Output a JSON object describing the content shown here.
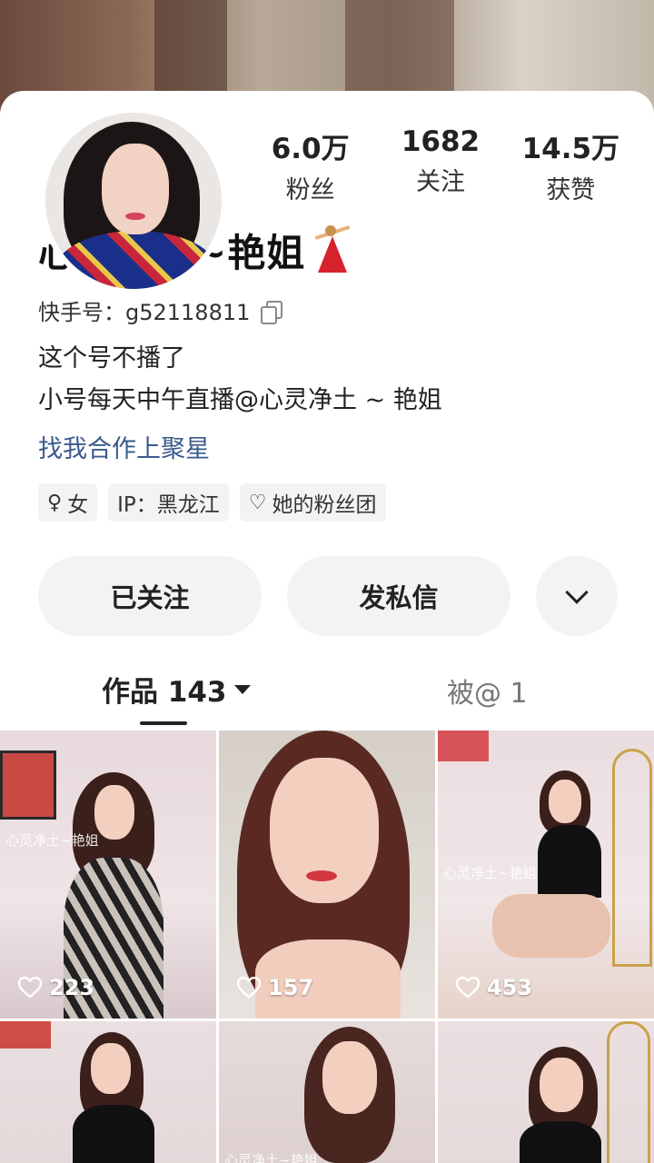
{
  "profile": {
    "name": "心灵净土~艳姐",
    "kuaishou_id": "快手号：g52118811",
    "bio_line1": "这个号不播了",
    "bio_line2": "小号每天中午直播@心灵净土 ~ 艳姐",
    "link": "找我合作上聚星"
  },
  "stats": [
    {
      "value": "6.0万",
      "label": "粉丝"
    },
    {
      "value": "1682",
      "label": "关注"
    },
    {
      "value": "14.5万",
      "label": "获赞"
    }
  ],
  "tags": [
    {
      "icon": "female-icon",
      "text": "女"
    },
    {
      "icon": "",
      "text": "IP：黑龙江"
    },
    {
      "icon": "heart-outline-icon",
      "text": "她的粉丝团"
    }
  ],
  "actions": {
    "follow": "已关注",
    "message": "发私信"
  },
  "tabs": {
    "works": "作品 143",
    "mentioned": "被@ 1"
  },
  "watermark": "心灵净土~艳姐",
  "videos": [
    {
      "likes": "223"
    },
    {
      "likes": "157"
    },
    {
      "likes": "453"
    },
    {
      "likes": ""
    },
    {
      "likes": ""
    },
    {
      "likes": ""
    }
  ],
  "colors": {
    "link": "#3a5a8c",
    "button_bg": "#f3f3f3",
    "text_primary": "#222222"
  }
}
